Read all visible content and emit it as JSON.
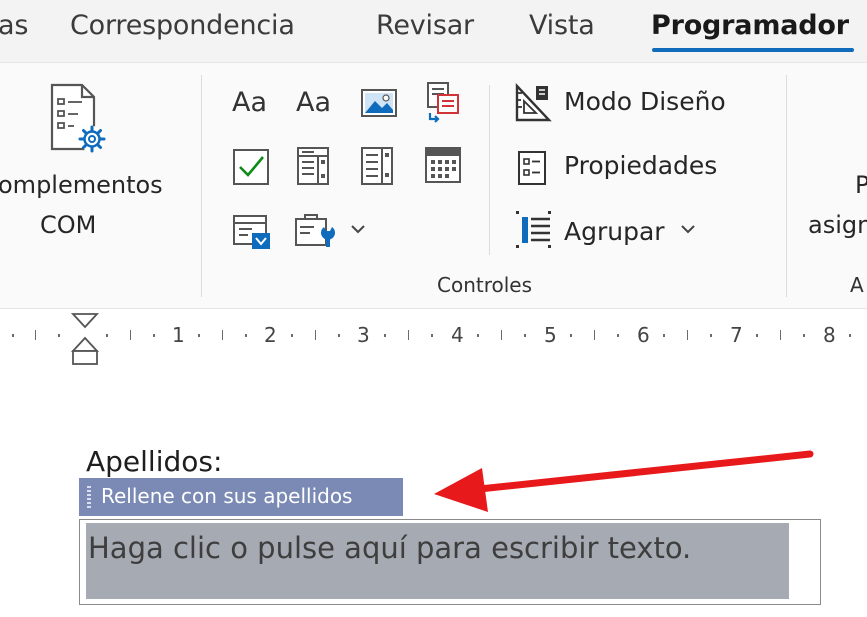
{
  "tabs": {
    "partial_left": "as",
    "correspondencia": "Correspondencia",
    "revisar": "Revisar",
    "vista": "Vista",
    "programador": "Programador"
  },
  "colors": {
    "accent": "#0f6cbd",
    "content_control_tag": "#7b8ab5",
    "placeholder_highlight": "#a6aab3",
    "annotation_arrow": "#e8191b"
  },
  "ribbon": {
    "complementos": {
      "line1": "omplementos",
      "line2": "COM",
      "icon": "gear-list-icon"
    },
    "controles": {
      "group_label": "Controles",
      "modo_diseno": "Modo Diseño",
      "propiedades": "Propiedades",
      "agrupar": "Agrupar",
      "rich_text_glyph": "Aa",
      "plain_text_glyph": "Aa"
    },
    "partial_right": {
      "line1": "P",
      "line2": "asign",
      "group_label": "A"
    }
  },
  "ruler": {
    "numbers": [
      "1",
      "2",
      "3",
      "4",
      "5",
      "6",
      "7",
      "8"
    ]
  },
  "document": {
    "field_label": "Apellidos:",
    "content_control_title": "Rellene con sus apellidos",
    "placeholder": "Haga clic o pulse aquí para escribir texto."
  }
}
